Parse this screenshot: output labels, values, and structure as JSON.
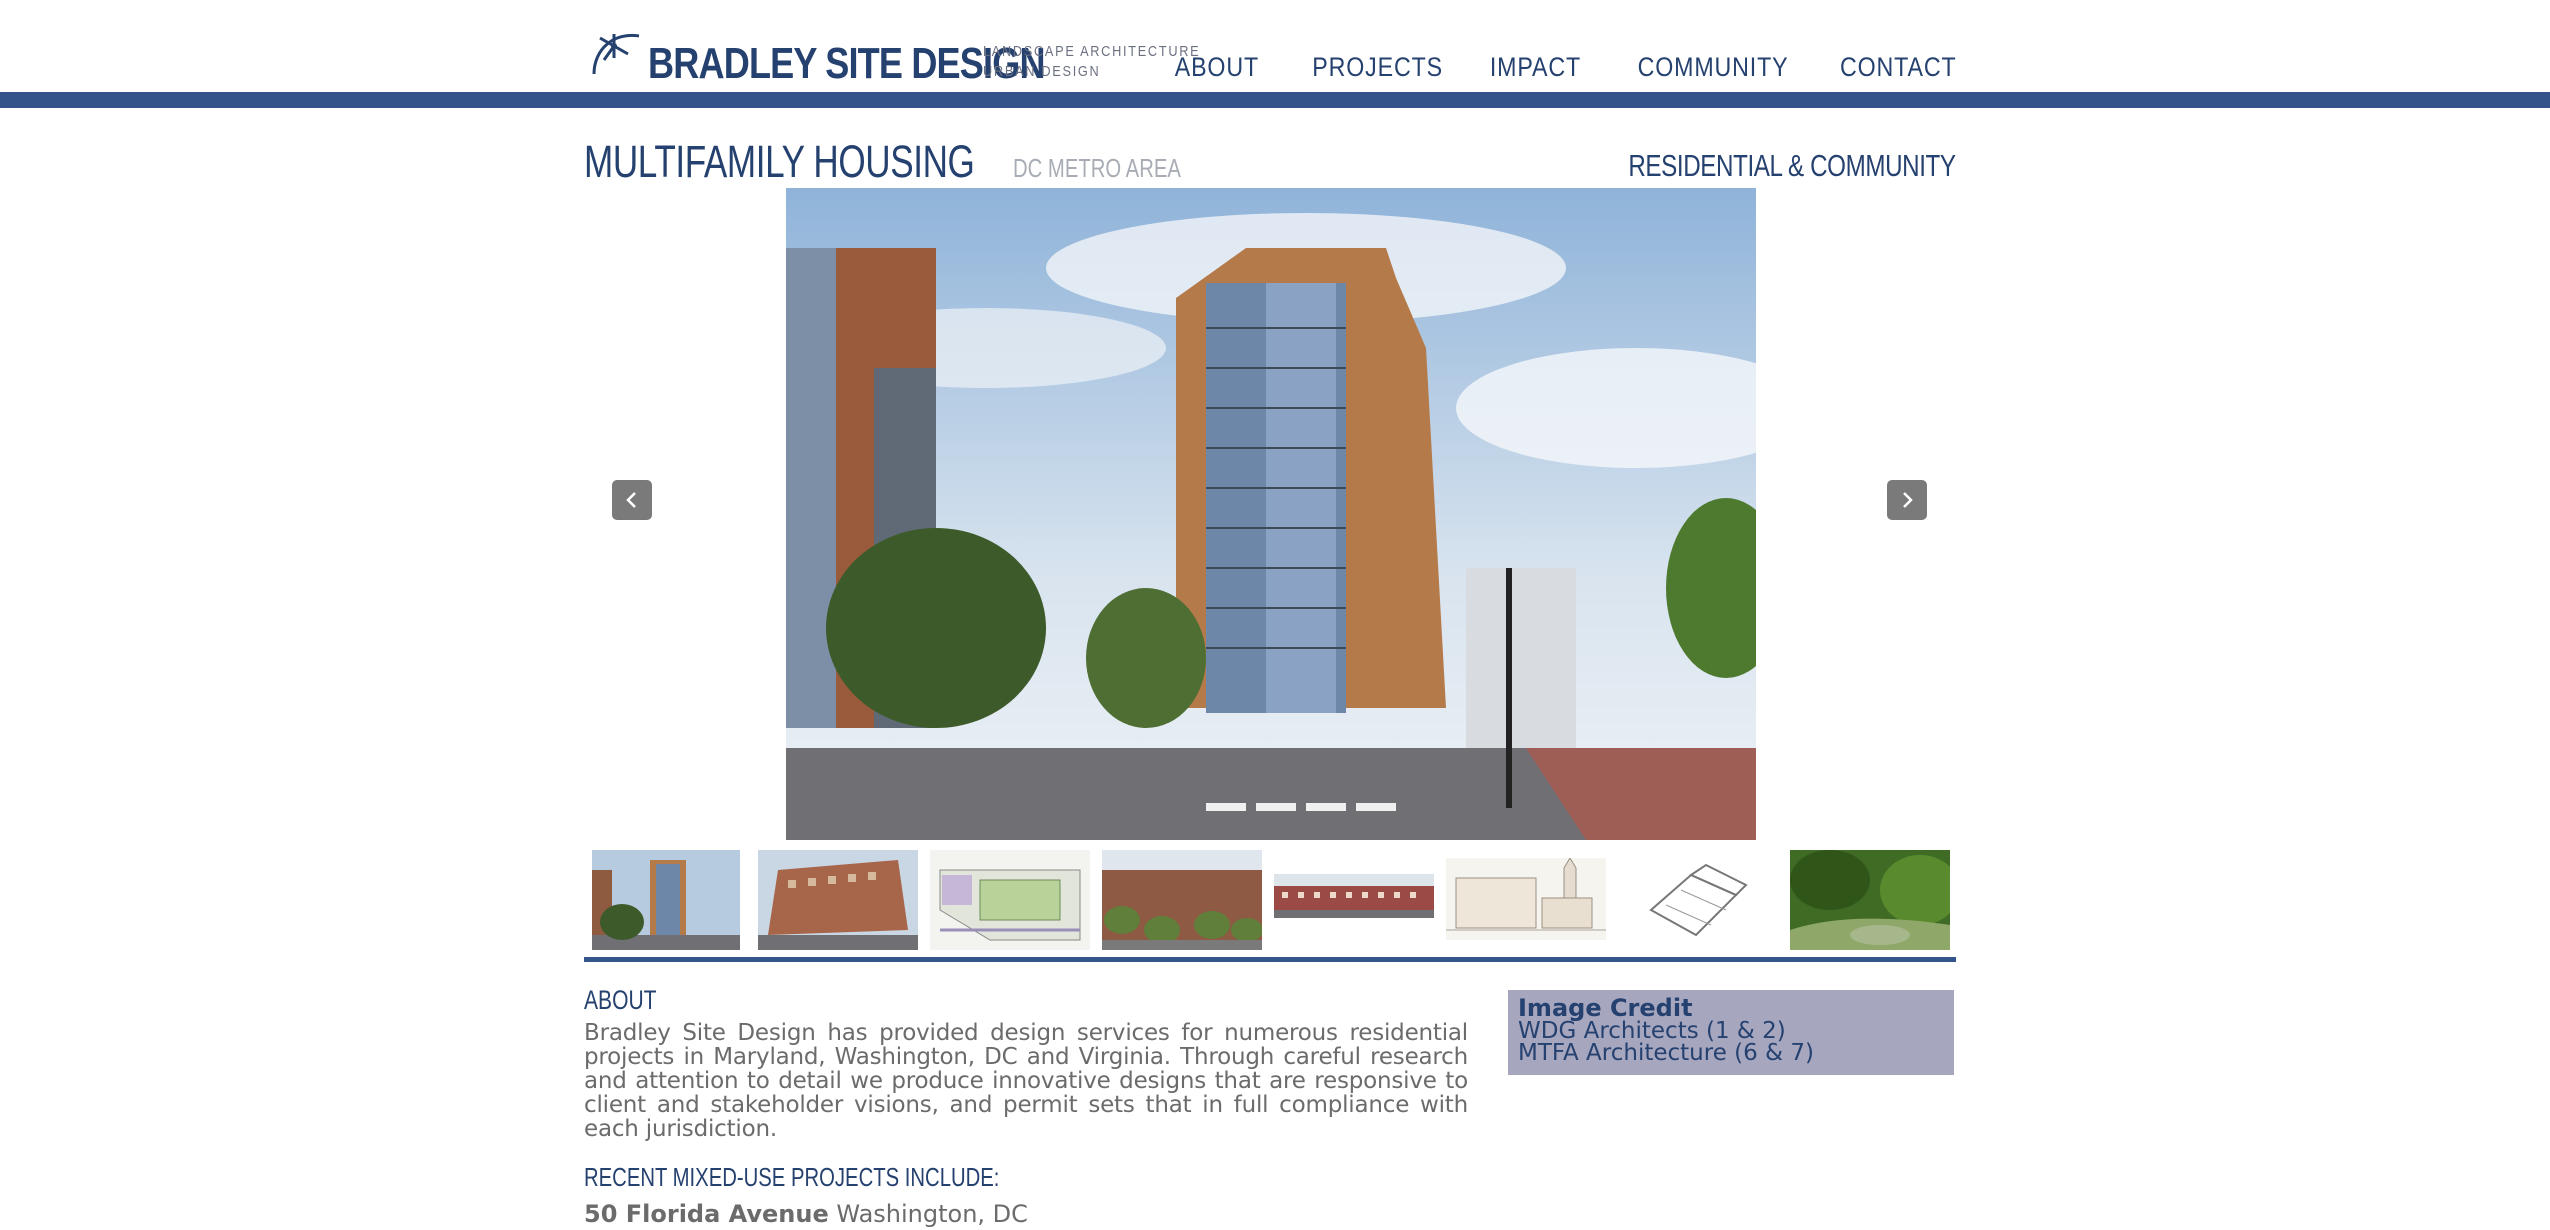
{
  "brand": {
    "name": "BRADLEY SITE DESIGN",
    "tagline_1": "LANDSCAPE ARCHITECTURE",
    "tagline_2": "URBAN DESIGN",
    "brand_color": "#25416f",
    "band_color": "#33558c"
  },
  "nav": {
    "items": [
      {
        "label": "ABOUT"
      },
      {
        "label": "PROJECTS"
      },
      {
        "label": "IMPACT"
      },
      {
        "label": "COMMUNITY"
      },
      {
        "label": "CONTACT"
      }
    ]
  },
  "project": {
    "title": "MULTIFAMILY HOUSING",
    "location": "DC METRO AREA",
    "category": "RESIDENTIAL & COMMUNITY"
  },
  "gallery": {
    "prev_icon": "chevron-left-icon",
    "next_icon": "chevron-right-icon",
    "thumbnail_count": 8
  },
  "about": {
    "heading": "ABOUT",
    "body": "Bradley Site Design has provided design services for numerous residential projects in Maryland, Washington, DC and Virginia. Through careful research and attention to detail we produce innovative designs that are responsive to client and stakeholder visions, and permit sets that in full compliance with each jurisdiction."
  },
  "recent": {
    "heading": "RECENT MIXED-USE PROJECTS INCLUDE:",
    "items": [
      {
        "name": "50 Florida Avenue",
        "location": "Washington, DC"
      }
    ]
  },
  "credit": {
    "title": "Image Credit",
    "lines": [
      "WDG Architects (1 & 2)",
      "MTFA Architecture (6 & 7)"
    ],
    "bg_color": "#a6a6bf"
  }
}
